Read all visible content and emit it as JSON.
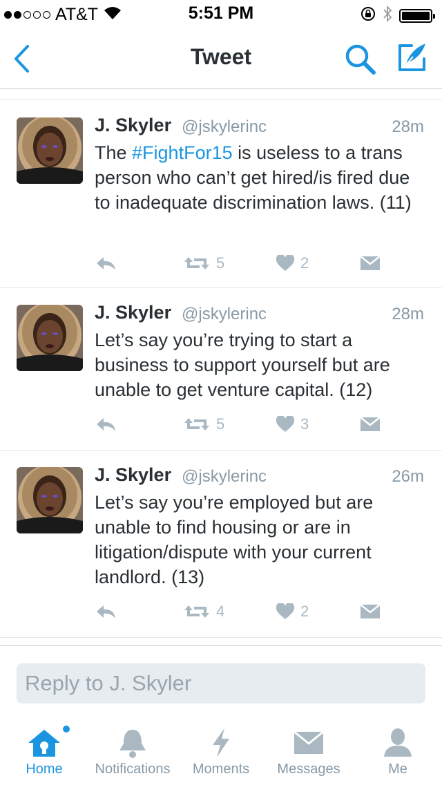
{
  "status_bar": {
    "carrier": "AT&T",
    "time": "5:51 PM"
  },
  "nav": {
    "title": "Tweet"
  },
  "tweets": [
    {
      "name": "J. Skyler",
      "handle": "@jskylerinc",
      "time": "28m",
      "text_before": "The ",
      "hashtag": "#FightFor15",
      "text_after": " is useless to a trans person who can’t get hired/is fired due to inadequate discrimination laws. (11)",
      "retweets": "5",
      "likes": "2"
    },
    {
      "name": "J. Skyler",
      "handle": "@jskylerinc",
      "time": "28m",
      "text": "Let’s say you’re trying to start a business to support yourself but are unable to get venture capital. (12)",
      "retweets": "5",
      "likes": "3"
    },
    {
      "name": "J. Skyler",
      "handle": "@jskylerinc",
      "time": "26m",
      "text": "Let’s say you’re employed but are unable to find housing or are in litigation/dispute with your current landlord. (13)",
      "retweets": "4",
      "likes": "2"
    }
  ],
  "reply": {
    "placeholder": "Reply to J. Skyler"
  },
  "tabs": [
    {
      "label": "Home",
      "icon": "home-icon",
      "active": true
    },
    {
      "label": "Notifications",
      "icon": "bell-icon"
    },
    {
      "label": "Moments",
      "icon": "lightning-icon"
    },
    {
      "label": "Messages",
      "icon": "envelope-icon"
    },
    {
      "label": "Me",
      "icon": "person-icon"
    }
  ],
  "colors": {
    "accent": "#1b95e0",
    "text": "#292f33",
    "muted": "#8899a6",
    "action": "#aab8c2"
  }
}
